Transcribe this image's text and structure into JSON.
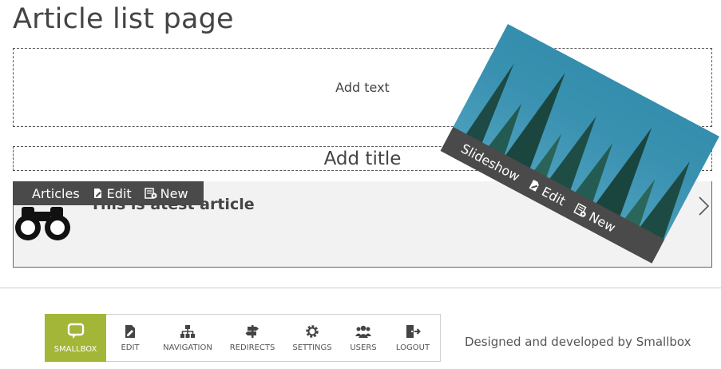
{
  "page": {
    "title": "Article list page"
  },
  "text_block": {
    "placeholder": "Add text"
  },
  "title_block": {
    "placeholder": "Add title"
  },
  "article_toolbar": {
    "articles_label": "Articles",
    "edit_label": "Edit",
    "new_label": "New"
  },
  "article": {
    "title": "This is atest article"
  },
  "slideshow_toolbar": {
    "slideshow_label": "Slideshow",
    "edit_label": "Edit",
    "new_label": "New"
  },
  "cms_bar": {
    "brand_label": "SMALLBOX",
    "items": [
      {
        "label": "EDIT",
        "icon": "edit-icon"
      },
      {
        "label": "NAVIGATION",
        "icon": "sitemap-icon"
      },
      {
        "label": "REDIRECTS",
        "icon": "signpost-icon"
      },
      {
        "label": "SETTINGS",
        "icon": "gear-icon"
      },
      {
        "label": "USERS",
        "icon": "users-icon"
      },
      {
        "label": "LOGOUT",
        "icon": "logout-icon"
      }
    ]
  },
  "footer": {
    "credits": "Designed and developed by Smallbox"
  },
  "colors": {
    "brand": "#a3b637",
    "toolbar": "#4a4a4a",
    "article_bg": "#f2f2f2"
  }
}
